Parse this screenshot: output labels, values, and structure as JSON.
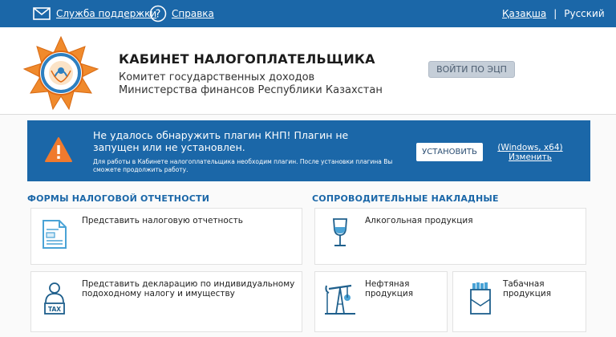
{
  "topbar": {
    "support_label": "Служба поддержки",
    "help_label": "Справка",
    "lang_kz": "Қазақша",
    "lang_sep": "|",
    "lang_ru": "Русский",
    "bg_color": "#1b67a8"
  },
  "header": {
    "title": "КАБИНЕТ НАЛОГОПЛАТЕЛЬЩИКА",
    "subtitle_line1": "Комитет государственных доходов",
    "subtitle_line2": "Министерства финансов Республики Казахстан",
    "login_button": "ВОЙТИ ПО ЭЦП"
  },
  "alert": {
    "title": "Не удалось обнаружить плагин КНП! Плагин не запущен или не установлен.",
    "description": "Для работы в Кабинете налогоплательщика необходим плагин. После установки плагина Вы сможете продолжить работу.",
    "install_button": "УСТАНОВИТЬ",
    "os_label": "(Windows, x64)",
    "change_label": "Изменить",
    "icon": "warning-icon"
  },
  "sections": {
    "tax_forms": {
      "title": "ФОРМЫ НАЛОГОВОЙ ОТЧЕТНОСТИ",
      "cards": [
        {
          "label": "Представить налоговую отчетность",
          "icon": "tax-report-icon"
        },
        {
          "label": "Представить декларацию по индивидуальному подоходному налогу и имуществу",
          "icon": "tax-person-icon"
        }
      ]
    },
    "waybills": {
      "title": "СОПРОВОДИТЕЛЬНЫЕ НАКЛАДНЫЕ",
      "cards": [
        {
          "label": "Алкогольная продукция",
          "icon": "wine-glass-icon"
        },
        {
          "label": "Нефтяная продукция",
          "icon": "oil-pump-icon"
        },
        {
          "label": "Табачная продукция",
          "icon": "cigarette-pack-icon"
        }
      ]
    }
  },
  "accent_color": "#1b67a8",
  "warning_color": "#f07a2e"
}
